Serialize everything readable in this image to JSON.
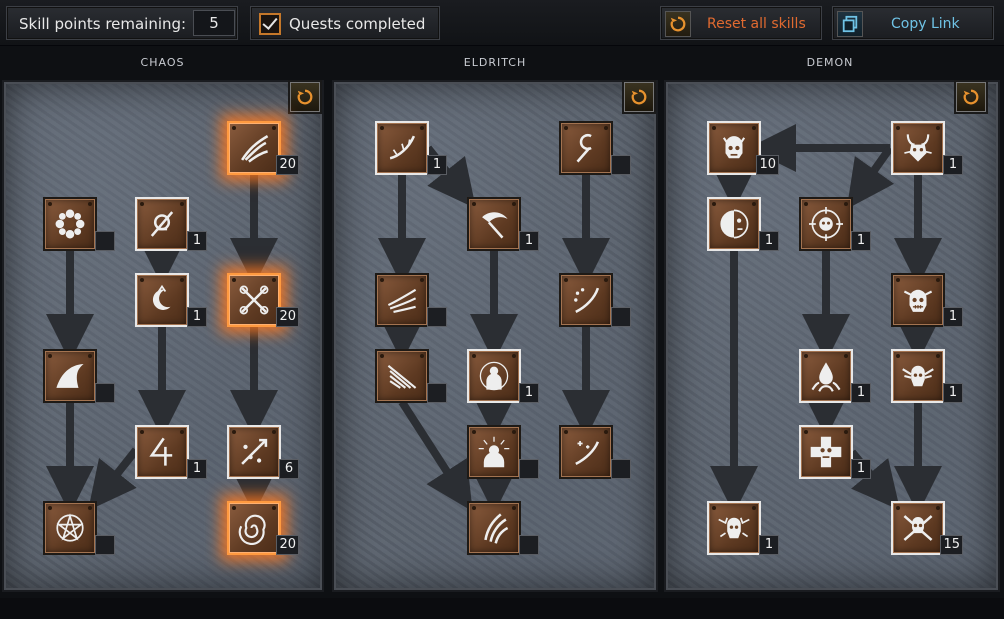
{
  "topbar": {
    "skill_points_label": "Skill points remaining:",
    "skill_points_value": "5",
    "quests_label": "Quests completed",
    "reset_label": "Reset all skills",
    "copy_label": "Copy Link"
  },
  "trees": [
    {
      "name": "CHAOS"
    },
    {
      "name": "ELDRITCH"
    },
    {
      "name": "DEMON"
    }
  ],
  "nodes": [
    {
      "id": "c1",
      "icon": "flower-icon",
      "level": ""
    },
    {
      "id": "c2",
      "icon": "cursed-sigil-icon",
      "level": "1"
    },
    {
      "id": "c3",
      "icon": "crescent-moon-icon",
      "level": "1"
    },
    {
      "id": "c4",
      "icon": "shark-fin-icon",
      "level": ""
    },
    {
      "id": "c5",
      "icon": "bent-arrow-rune-icon",
      "level": "1"
    },
    {
      "id": "c6",
      "icon": "pentagram-icon",
      "level": ""
    },
    {
      "id": "c7",
      "icon": "flame-claw-icon",
      "level": "20"
    },
    {
      "id": "c8",
      "icon": "crossed-chains-icon",
      "level": "20"
    },
    {
      "id": "c9",
      "icon": "scatter-bolt-icon",
      "level": "6"
    },
    {
      "id": "c10",
      "icon": "spiral-vortex-icon",
      "level": "20"
    },
    {
      "id": "e1",
      "icon": "thorn-whip-icon",
      "level": "1"
    },
    {
      "id": "e2",
      "icon": "scythe-icon",
      "level": "1"
    },
    {
      "id": "e3",
      "icon": "serpent-staff-icon",
      "level": ""
    },
    {
      "id": "e4",
      "icon": "wind-claw-icon",
      "level": ""
    },
    {
      "id": "e5",
      "icon": "sparkle-blade-icon",
      "level": ""
    },
    {
      "id": "e6",
      "icon": "feather-wing-icon",
      "level": ""
    },
    {
      "id": "e7",
      "icon": "hooded-figure-icon",
      "level": "1"
    },
    {
      "id": "e8",
      "icon": "radiant-bust-icon",
      "level": ""
    },
    {
      "id": "e9",
      "icon": "star-blade-icon",
      "level": ""
    },
    {
      "id": "e10",
      "icon": "triple-claw-icon",
      "level": ""
    },
    {
      "id": "d1",
      "icon": "demon-skull-icon",
      "level": "10"
    },
    {
      "id": "d2",
      "icon": "horned-demon-icon",
      "level": "1"
    },
    {
      "id": "d3",
      "icon": "half-mask-icon",
      "level": "1"
    },
    {
      "id": "d4",
      "icon": "target-skull-icon",
      "level": "1"
    },
    {
      "id": "d5",
      "icon": "grinning-skull-icon",
      "level": "1"
    },
    {
      "id": "d6",
      "icon": "flame-drop-icon",
      "level": "1"
    },
    {
      "id": "d7",
      "icon": "winged-skull-icon",
      "level": "1"
    },
    {
      "id": "d8",
      "icon": "cross-skull-icon",
      "level": "1"
    },
    {
      "id": "d9",
      "icon": "bat-skull-icon",
      "level": "1"
    },
    {
      "id": "d10",
      "icon": "crossbones-skull-icon",
      "level": "15"
    }
  ]
}
